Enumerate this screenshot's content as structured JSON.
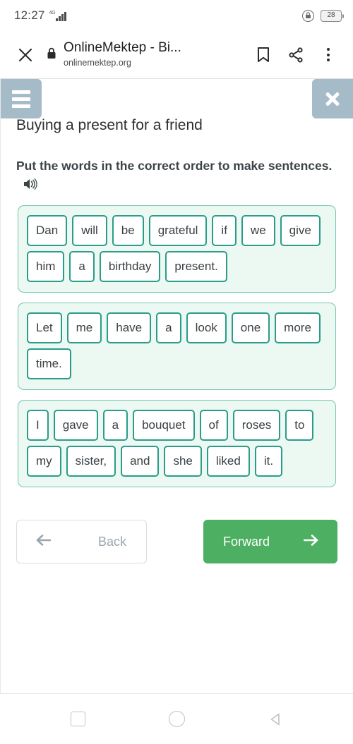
{
  "status_bar": {
    "time": "12:27",
    "network_label": "4G",
    "signal_icon": "signal-bars-icon",
    "lock_icon": "screen-lock-rotation-icon",
    "battery_level": "28"
  },
  "browser": {
    "close_icon": "close-icon",
    "security_icon": "padlock-icon",
    "page_title": "OnlineMektep - Bi...",
    "page_host": "onlinemektep.org",
    "bookmark_icon": "bookmark-icon",
    "share_icon": "share-icon",
    "overflow_icon": "more-vertical-icon"
  },
  "page": {
    "menu_icon": "hamburger-menu-icon",
    "close_icon": "close-icon",
    "lesson_title": "Buying a present for a friend",
    "instruction": "Put the words in the correct order to make sentences.",
    "audio_icon": "speaker-icon",
    "accent_color": "#2a9d8a",
    "box_background": "#ecf8f2",
    "button_color": "#4caf61",
    "sentences": [
      {
        "id": "sentence-1",
        "words": [
          "Dan",
          "will",
          "be",
          "grateful",
          "if",
          "we",
          "give",
          "him",
          "a",
          "birthday",
          "present."
        ]
      },
      {
        "id": "sentence-2",
        "words": [
          "Let",
          "me",
          "have",
          "a",
          "look",
          "one",
          "more",
          "time."
        ]
      },
      {
        "id": "sentence-3",
        "words": [
          "I",
          "gave",
          "a",
          "bouquet",
          "of",
          "roses",
          "to",
          "my",
          "sister,",
          "and",
          "she",
          "liked",
          "it."
        ]
      }
    ],
    "back_label": "Back",
    "back_icon": "arrow-left-icon",
    "forward_label": "Forward",
    "forward_icon": "arrow-right-icon"
  },
  "android_nav": {
    "recents_icon": "square-recents-icon",
    "home_icon": "circle-home-icon",
    "back_icon": "triangle-back-icon"
  }
}
